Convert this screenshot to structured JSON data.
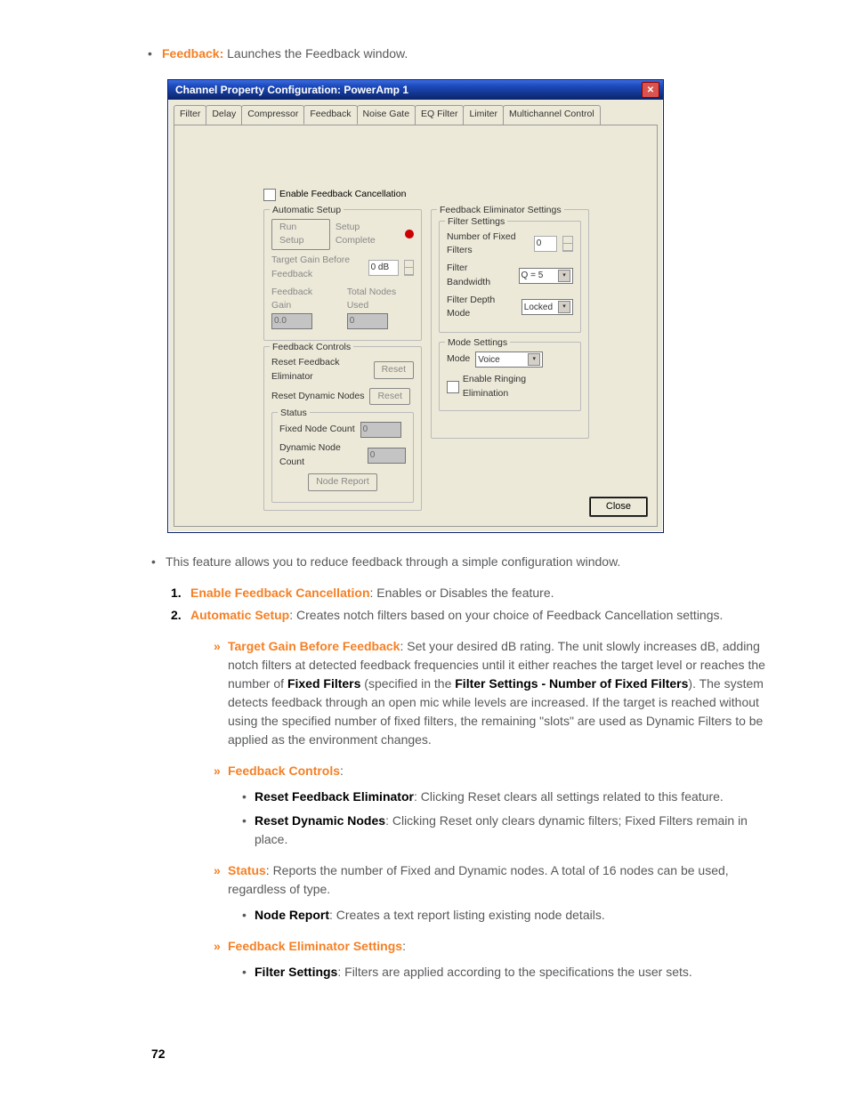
{
  "intro": {
    "label": "Feedback:",
    "text": " Launches the Feedback window."
  },
  "window": {
    "title": "Channel Property Configuration: PowerAmp 1",
    "tabs": [
      "Filter",
      "Delay",
      "Compressor",
      "Feedback",
      "Noise Gate",
      "EQ Filter",
      "Limiter",
      "Multichannel Control"
    ],
    "active_tab": 3,
    "enable_chk": "Enable Feedback Cancellation",
    "auto_setup": {
      "legend": "Automatic Setup",
      "run_setup": "Run Setup",
      "setup_complete": "Setup Complete",
      "target_label": "Target Gain Before Feedback",
      "target_value": "0 dB",
      "feedback_gain_label": "Feedback Gain",
      "feedback_gain_value": "0.0",
      "total_nodes_label": "Total Nodes Used",
      "total_nodes_value": "0"
    },
    "controls": {
      "legend": "Feedback Controls",
      "reset_fb": "Reset Feedback Eliminator",
      "reset_dyn": "Reset Dynamic Nodes",
      "reset_btn": "Reset"
    },
    "status": {
      "legend": "Status",
      "fixed": "Fixed Node Count",
      "fixed_val": "0",
      "dynamic": "Dynamic Node Count",
      "dynamic_val": "0",
      "node_report": "Node Report"
    },
    "fbes": {
      "legend": "Feedback Eliminator Settings",
      "filter_legend": "Filter Settings",
      "num_fixed": "Number of Fixed Filters",
      "num_fixed_val": "0",
      "bandwidth": "Filter Bandwidth",
      "bandwidth_val": "Q = 5",
      "depth": "Filter Depth Mode",
      "depth_val": "Locked",
      "mode_legend": "Mode Settings",
      "mode_label": "Mode",
      "mode_val": "Voice",
      "ere": "Enable Ringing Elimination"
    },
    "close": "Close"
  },
  "body": {
    "lead": "This feature allows you to reduce feedback through a simple configuration window.",
    "ol1_lead": "Enable Feedback Cancellation",
    "ol1_tail": ": Enables or Disables the feature.",
    "ol2_lead": "Automatic Setup",
    "ol2_tail": ": Creates notch filters based on your choice of Feedback Cancellation settings.",
    "c1_lead": "Target Gain Before Feedback",
    "c1a": ": Set your desired dB rating. The unit slowly increases dB, adding notch filters at detected feedback frequencies until it either reaches the target level or reaches the number of ",
    "c1b": "Fixed Filters",
    "c1c": " (specified in the ",
    "c1d": "Filter Settings - Number of Fixed Filters",
    "c1e": "). The system detects feedback through an open mic while levels are increased. If the target is reached without using the specified number of fixed filters, the remaining \"slots\" are used as Dynamic Filters to be applied as the environment changes.",
    "c2_lead": "Feedback Controls",
    "c2_tail": ":",
    "s1_lead": "Reset Feedback Eliminator",
    "s1_tail": ": Clicking Reset clears all settings related to this feature.",
    "s2_lead": "Reset Dynamic Nodes",
    "s2_tail": ": Clicking Reset only clears dynamic filters; Fixed Filters remain in place.",
    "c3_lead": "Status",
    "c3_tail": ": Reports the number of Fixed and Dynamic nodes. A total of 16 nodes can be used, regardless of type.",
    "s3_lead": "Node Report",
    "s3_tail": ": Creates a text report listing existing node details.",
    "c4_lead": "Feedback Eliminator Settings",
    "c4_tail": ":",
    "s4_lead": "Filter Settings",
    "s4_tail": ": Filters are applied according to the specifications the user sets."
  },
  "page_number": "72"
}
